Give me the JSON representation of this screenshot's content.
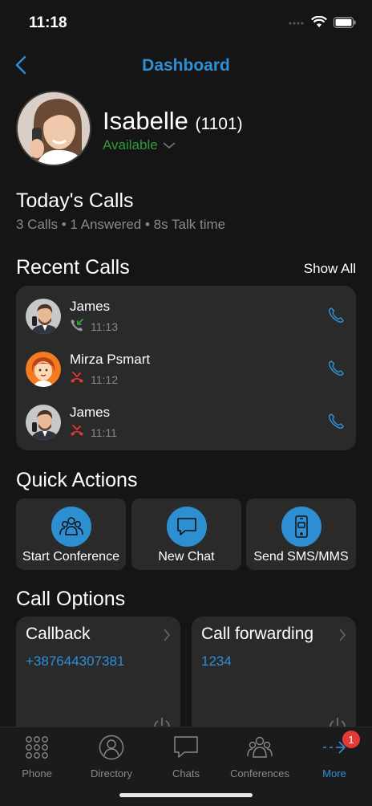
{
  "status_bar": {
    "time": "11:18"
  },
  "nav": {
    "title": "Dashboard"
  },
  "profile": {
    "name": "Isabelle",
    "extension": "(1101)",
    "status": "Available"
  },
  "todays_calls": {
    "title": "Today's Calls",
    "calls": "3 Calls",
    "answered": "1 Answered",
    "talk_time": "8s Talk time",
    "separator": "•"
  },
  "recent_calls": {
    "title": "Recent Calls",
    "show_all_label": "Show All",
    "items": [
      {
        "name": "James",
        "time": "11:13",
        "type": "incoming-answered",
        "icon": "call-incoming-icon",
        "icon_color": "#3aa23a"
      },
      {
        "name": "Mirza Psmart",
        "time": "11:12",
        "type": "missed",
        "icon": "call-missed-icon",
        "icon_color": "#e53935"
      },
      {
        "name": "James",
        "time": "11:11",
        "type": "missed",
        "icon": "call-missed-icon",
        "icon_color": "#e53935"
      }
    ]
  },
  "quick_actions": {
    "title": "Quick Actions",
    "items": [
      {
        "label": "Start Conference",
        "icon": "conference-icon"
      },
      {
        "label": "New Chat",
        "icon": "chat-bubble-icon"
      },
      {
        "label": "Send SMS/MMS",
        "icon": "mobile-phone-icon"
      }
    ]
  },
  "call_options": {
    "title": "Call Options",
    "items": [
      {
        "title": "Callback",
        "value": "+387644307381"
      },
      {
        "title": "Call forwarding",
        "value": "1234"
      }
    ]
  },
  "tabbar": {
    "items": [
      {
        "label": "Phone",
        "icon": "dialpad-icon"
      },
      {
        "label": "Directory",
        "icon": "person-icon"
      },
      {
        "label": "Chats",
        "icon": "chat-bubble-icon"
      },
      {
        "label": "Conferences",
        "icon": "conference-icon"
      },
      {
        "label": "More",
        "icon": "more-arrow-icon",
        "badge": "1",
        "active": true
      }
    ]
  },
  "colors": {
    "accent": "#2e8fd6",
    "available": "#2f9a3c",
    "missed": "#e53935",
    "answered": "#3aa23a",
    "badge": "#e53935"
  }
}
